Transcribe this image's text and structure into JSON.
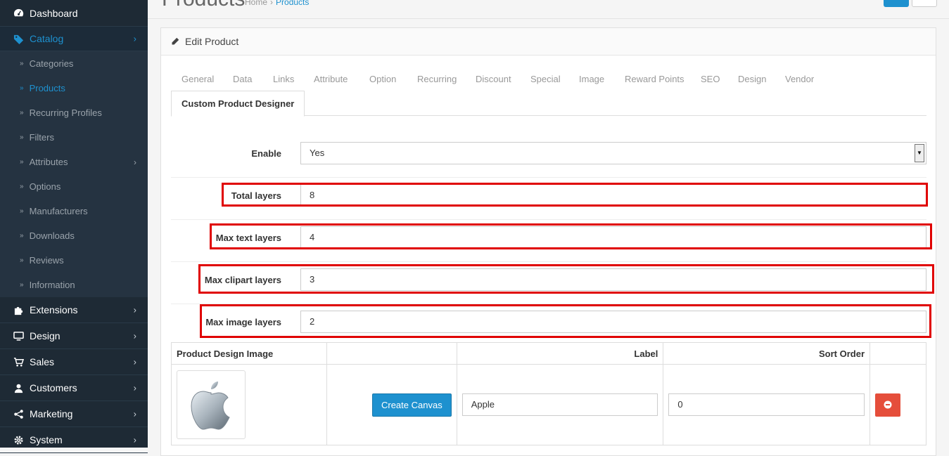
{
  "sidebar": {
    "items": [
      {
        "label": "Dashboard",
        "icon": "dashboard-icon"
      },
      {
        "label": "Catalog",
        "icon": "tag-icon",
        "active": true
      },
      {
        "label": "Extensions",
        "icon": "puzzle-icon"
      },
      {
        "label": "Design",
        "icon": "monitor-icon"
      },
      {
        "label": "Sales",
        "icon": "cart-icon"
      },
      {
        "label": "Customers",
        "icon": "user-icon"
      },
      {
        "label": "Marketing",
        "icon": "share-icon"
      },
      {
        "label": "System",
        "icon": "gear-icon"
      }
    ],
    "catalog_sub": [
      {
        "label": "Categories"
      },
      {
        "label": "Products",
        "active": true
      },
      {
        "label": "Recurring Profiles"
      },
      {
        "label": "Filters"
      },
      {
        "label": "Attributes"
      },
      {
        "label": "Options"
      },
      {
        "label": "Manufacturers"
      },
      {
        "label": "Downloads"
      },
      {
        "label": "Reviews"
      },
      {
        "label": "Information"
      }
    ]
  },
  "header": {
    "title": "Products",
    "breadcrumb": [
      "Home",
      "Products"
    ]
  },
  "panel": {
    "title": "Edit Product"
  },
  "tabs": [
    "General",
    "Data",
    "Links",
    "Attribute",
    "Option",
    "Recurring",
    "Discount",
    "Special",
    "Image",
    "Reward Points",
    "SEO",
    "Design",
    "Vendor",
    "Custom Product Designer"
  ],
  "form": {
    "enable_label": "Enable",
    "enable_value": "Yes",
    "total_layers_label": "Total layers",
    "total_layers_value": "8",
    "max_text_label": "Max text layers",
    "max_text_value": "4",
    "max_clipart_label": "Max clipart layers",
    "max_clipart_value": "3",
    "max_image_label": "Max image layers",
    "max_image_value": "2"
  },
  "table": {
    "headers": [
      "Product Design Image",
      "",
      "Label",
      "Sort Order",
      ""
    ],
    "rows": [
      {
        "image": "apple-logo",
        "button": "Create Canvas",
        "label": "Apple",
        "sort_order": "0"
      }
    ]
  },
  "colors": {
    "sidebar_bg": "#1e2a35",
    "accent": "#1e91cf",
    "danger": "#e54e3b",
    "highlight": "#e00000"
  }
}
